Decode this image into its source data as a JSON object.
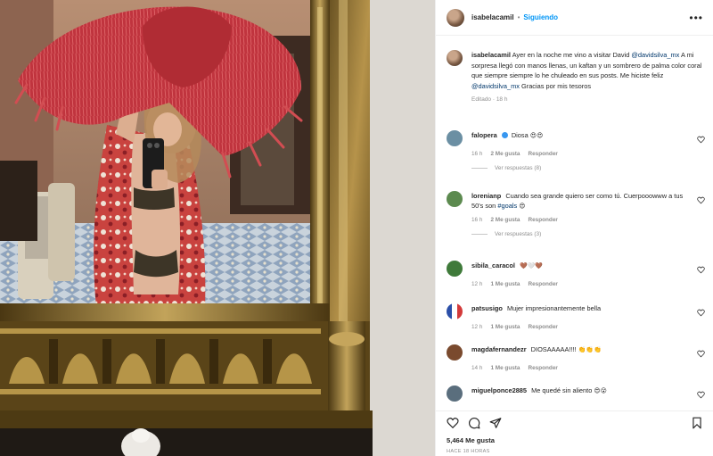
{
  "post": {
    "username": "isabelacamil",
    "follow_label": "Siguiendo",
    "more_label": "•••"
  },
  "caption": {
    "username": "isabelacamil",
    "text_1": "Ayer en la noche me vino a visitar David",
    "mention_1": "@davidsilva_mx",
    "text_2": "A mi sorpresa llegó con manos llenas, un kaftan y un sombrero de palma color coral que siempre siempre lo he chuleado en sus posts. Me hiciste feliz",
    "mention_2": "@davidsilva_mx",
    "text_3": "Gracias por mis tesoros",
    "meta": "Editado · 18 h"
  },
  "comments": [
    {
      "username": "falopera",
      "text": "Diosa",
      "emoji": "😍😍",
      "verified": true,
      "time": "16 h",
      "likes": "2 Me gusta",
      "reply": "Responder",
      "view_replies": "Ver respuestas (8)",
      "avatar_color": "#6b8fa3"
    },
    {
      "username": "lorenianp",
      "text": "Cuando sea grande quiero ser como tú. Cuerpooowww a tus 50's son",
      "hashtag": "#goals",
      "emoji": "😍",
      "time": "16 h",
      "likes": "2 Me gusta",
      "reply": "Responder",
      "view_replies": "Ver respuestas (3)",
      "avatar_color": "#5c8a4f"
    },
    {
      "username": "sibila_caracol",
      "text": "",
      "emoji": "🤎🤍🤎",
      "time": "12 h",
      "likes": "1 Me gusta",
      "reply": "Responder",
      "avatar_color": "#3f7a3a"
    },
    {
      "username": "patsusigo",
      "text": "Mujer impresionantemente bella",
      "emoji": "",
      "time": "12 h",
      "likes": "1 Me gusta",
      "reply": "Responder",
      "avatar_color": "#2b4fa8"
    },
    {
      "username": "magdafernandezr",
      "text": "DIOSAAAAA!!!!",
      "emoji": "👏👏👏",
      "time": "14 h",
      "likes": "1 Me gusta",
      "reply": "Responder",
      "avatar_color": "#7a4a2e"
    },
    {
      "username": "miguelponce2885",
      "text": "Me quedé sin aliento",
      "emoji": "😍😮",
      "time": "",
      "likes": "",
      "reply": "",
      "avatar_color": "#5a6e7d"
    }
  ],
  "actions": {
    "likes": "5,464 Me gusta",
    "date": "HACE 18 HORAS"
  },
  "icons": [
    "heart-icon",
    "comment-icon",
    "share-icon",
    "bookmark-icon"
  ],
  "colors": {
    "link": "#00376b",
    "follow": "#0095f6",
    "muted": "#8e8e8e",
    "hat_coral": "#c94a4f",
    "mirror_gold": "#a8863c"
  }
}
